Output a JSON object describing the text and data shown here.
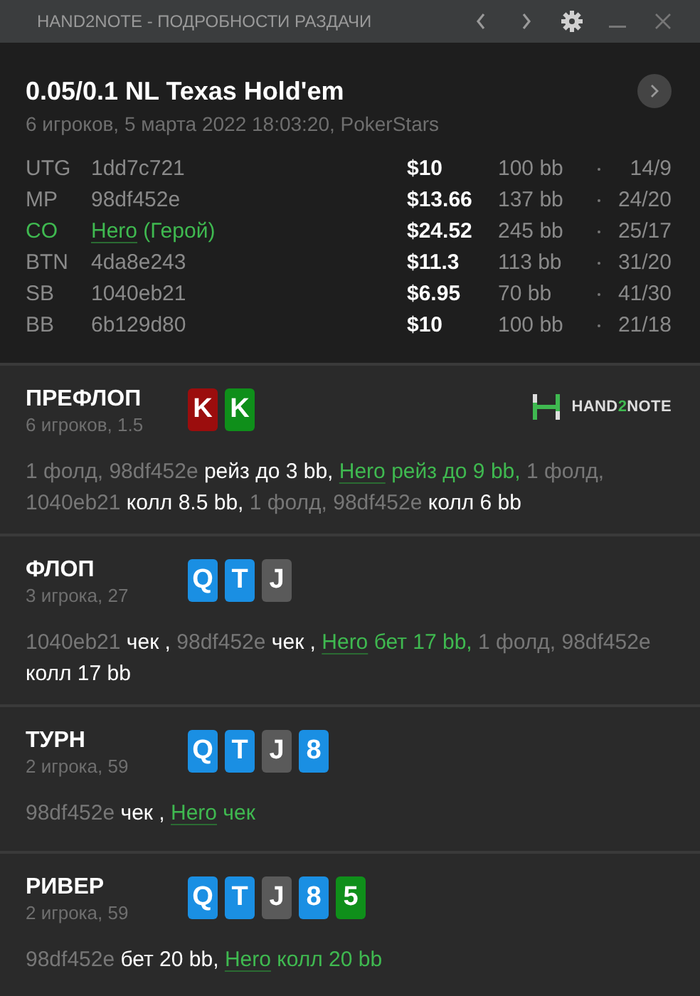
{
  "window": {
    "title": "HAND2NOTE - ПОДРОБНОСТИ РАЗДАЧИ"
  },
  "hand": {
    "title": "0.05/0.1 NL Texas Hold'em",
    "meta": "6 игроков, 5 марта 2022 18:03:20, PokerStars"
  },
  "players": [
    {
      "position": "UTG",
      "name": "1dd7c721",
      "hero": false,
      "stack": "$10",
      "bb": "100 bb",
      "stats": "14/9"
    },
    {
      "position": "MP",
      "name": "98df452e",
      "hero": false,
      "stack": "$13.66",
      "bb": "137 bb",
      "stats": "24/20"
    },
    {
      "position": "CO",
      "name": "Hero",
      "suffix": "(Герой)",
      "hero": true,
      "stack": "$24.52",
      "bb": "245 bb",
      "stats": "25/17"
    },
    {
      "position": "BTN",
      "name": "4da8e243",
      "hero": false,
      "stack": "$11.3",
      "bb": "113 bb",
      "stats": "31/20"
    },
    {
      "position": "SB",
      "name": "1040eb21",
      "hero": false,
      "stack": "$6.95",
      "bb": "70 bb",
      "stats": "41/30"
    },
    {
      "position": "BB",
      "name": "6b129d80",
      "hero": false,
      "stack": "$10",
      "bb": "100 bb",
      "stats": "21/18"
    }
  ],
  "streets": [
    {
      "name": "ПРЕФЛОП",
      "meta": "6 игроков, 1.5",
      "logo": {
        "prefix": "HAND",
        "accent": "2",
        "suffix": "NOTE"
      },
      "cards": [
        {
          "rank": "K",
          "color": "#9b0d0d"
        },
        {
          "rank": "K",
          "color": "#0f8f1a"
        }
      ],
      "actions": [
        {
          "kind": "fold",
          "text": "1 фолд,"
        },
        {
          "kind": "move",
          "player": "98df452e",
          "text": "рейз до 3 bb,"
        },
        {
          "kind": "hero",
          "player": "Hero",
          "text": "рейз до 9 bb,"
        },
        {
          "kind": "fold",
          "text": "1 фолд,"
        },
        {
          "kind": "move",
          "player": "1040eb21",
          "text": "колл 8.5 bb,"
        },
        {
          "kind": "fold",
          "text": "1 фолд,"
        },
        {
          "kind": "move",
          "player": "98df452e",
          "text": "колл 6 bb"
        }
      ]
    },
    {
      "name": "ФЛОП",
      "meta": "3 игрока, 27",
      "cards": [
        {
          "rank": "Q",
          "color": "#1a8fe3"
        },
        {
          "rank": "T",
          "color": "#1a8fe3"
        },
        {
          "rank": "J",
          "color": "#5a5a5a"
        }
      ],
      "actions": [
        {
          "kind": "move",
          "player": "1040eb21",
          "text": "чек ,"
        },
        {
          "kind": "move",
          "player": "98df452e",
          "text": "чек ,"
        },
        {
          "kind": "hero",
          "player": "Hero",
          "text": "бет 17 bb,"
        },
        {
          "kind": "fold",
          "text": "1 фолд,"
        },
        {
          "kind": "move",
          "player": "98df452e",
          "text": "колл 17 bb"
        }
      ]
    },
    {
      "name": "ТУРН",
      "meta": "2 игрока, 59",
      "cards": [
        {
          "rank": "Q",
          "color": "#1a8fe3"
        },
        {
          "rank": "T",
          "color": "#1a8fe3"
        },
        {
          "rank": "J",
          "color": "#5a5a5a"
        },
        {
          "rank": "8",
          "color": "#1a8fe3"
        }
      ],
      "actions": [
        {
          "kind": "move",
          "player": "98df452e",
          "text": "чек ,"
        },
        {
          "kind": "hero",
          "player": "Hero",
          "text": "чек"
        }
      ]
    },
    {
      "name": "РИВЕР",
      "meta": "2 игрока, 59",
      "cards": [
        {
          "rank": "Q",
          "color": "#1a8fe3"
        },
        {
          "rank": "T",
          "color": "#1a8fe3"
        },
        {
          "rank": "J",
          "color": "#5a5a5a"
        },
        {
          "rank": "8",
          "color": "#1a8fe3"
        },
        {
          "rank": "5",
          "color": "#0f8f1a"
        }
      ],
      "actions": [
        {
          "kind": "move",
          "player": "98df452e",
          "text": "бет 20 bb,"
        },
        {
          "kind": "hero",
          "player": "Hero",
          "text": "колл 20 bb"
        }
      ]
    }
  ]
}
